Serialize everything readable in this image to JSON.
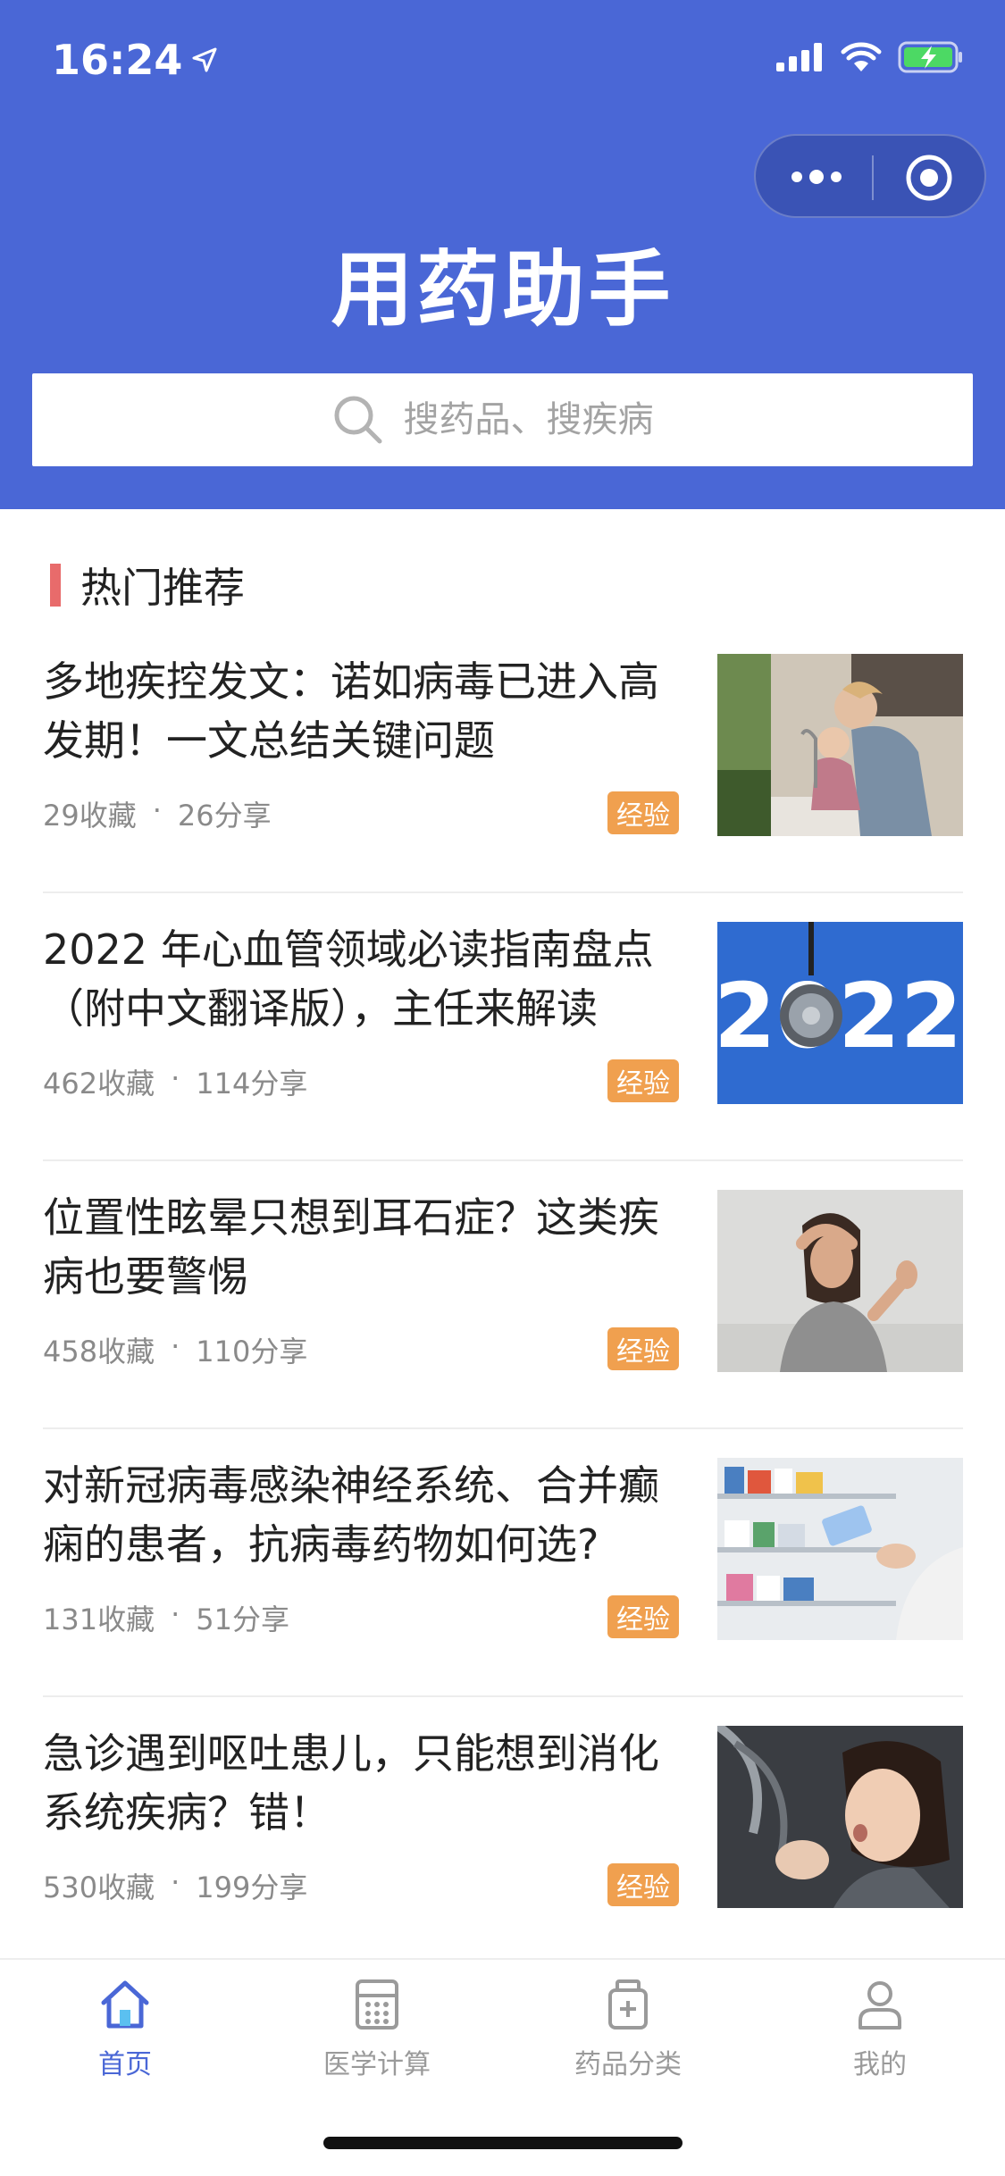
{
  "status_bar": {
    "time": "16:24",
    "icons": [
      "location-arrow-icon",
      "signal-icon",
      "wifi-icon",
      "battery-charging-icon"
    ]
  },
  "header": {
    "title": "用药助手",
    "search_placeholder": "搜药品、搜疾病",
    "background_color": "#4a67d6"
  },
  "section": {
    "title": "热门推荐",
    "accent_color": "#e86b6b"
  },
  "articles": [
    {
      "title": "多地疾控发文：诺如病毒已进入高发期！一文总结关键问题",
      "favorites": "29收藏",
      "shares": "26分享",
      "tag": "经验",
      "image": "mother-washing-child-hands"
    },
    {
      "title": "2022 年心血管领域必读指南盘点（附中文翻译版），主任来解读",
      "favorites": "462收藏",
      "shares": "114分享",
      "tag": "经验",
      "image": "stethoscope-2022",
      "image_text": "2022"
    },
    {
      "title": "位置性眩晕只想到耳石症？这类疾病也要警惕",
      "favorites": "458收藏",
      "shares": "110分享",
      "tag": "经验",
      "image": "dizzy-woman"
    },
    {
      "title": "对新冠病毒感染神经系统、合并癫痫的患者，抗病毒药物如何选?",
      "favorites": "131收藏",
      "shares": "51分享",
      "tag": "经验",
      "image": "pharmacy-shelves"
    },
    {
      "title": "急诊遇到呕吐患儿，只能想到消化系统疾病？错！",
      "favorites": "530收藏",
      "shares": "199分享",
      "tag": "经验",
      "image": "child-vomiting"
    }
  ],
  "tabbar": {
    "items": [
      {
        "label": "首页",
        "icon": "home-icon",
        "active": true
      },
      {
        "label": "医学计算",
        "icon": "calculator-icon",
        "active": false
      },
      {
        "label": "药品分类",
        "icon": "medicine-bottle-icon",
        "active": false
      },
      {
        "label": "我的",
        "icon": "user-icon",
        "active": false
      }
    ],
    "active_color": "#4a67d6"
  }
}
